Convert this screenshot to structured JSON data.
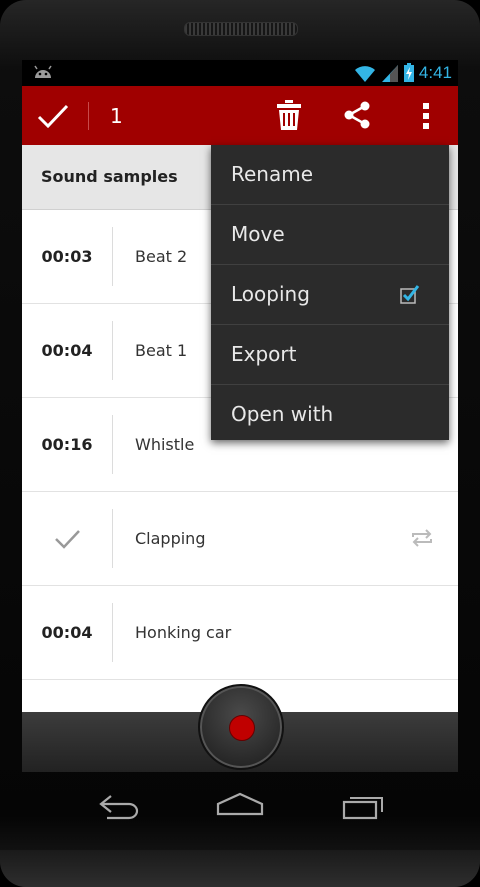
{
  "status": {
    "time": "4:41"
  },
  "actionbar": {
    "selected_count": "1"
  },
  "section": {
    "title": "Sound samples"
  },
  "list": {
    "items": [
      {
        "duration": "00:03",
        "name": "Beat 2",
        "checked": false,
        "looping": false
      },
      {
        "duration": "00:04",
        "name": "Beat 1",
        "checked": false,
        "looping": false
      },
      {
        "duration": "00:16",
        "name": "Whistle",
        "checked": false,
        "looping": false
      },
      {
        "duration": "",
        "name": "Clapping",
        "checked": true,
        "looping": true
      },
      {
        "duration": "00:04",
        "name": "Honking car",
        "checked": false,
        "looping": false
      }
    ]
  },
  "menu": {
    "items": [
      {
        "label": "Rename"
      },
      {
        "label": "Move"
      },
      {
        "label": "Looping",
        "checked": true
      },
      {
        "label": "Export"
      },
      {
        "label": "Open with"
      }
    ]
  },
  "colors": {
    "actionbar": "#a00000",
    "accent": "#33b5e5",
    "record": "#c00000"
  }
}
